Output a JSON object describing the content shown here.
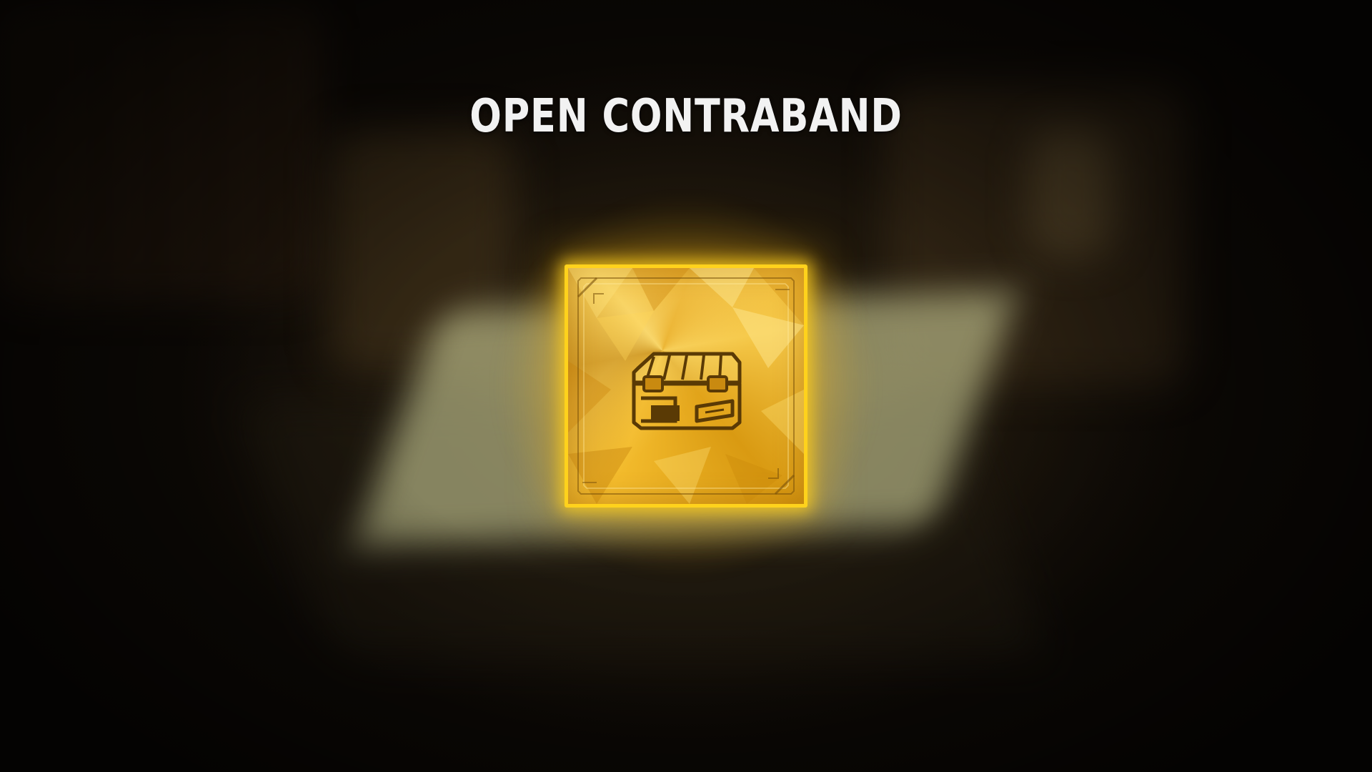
{
  "screen": {
    "title": "OPEN CONTRABAND"
  },
  "contraband_item": {
    "icon": "contraband-chest-icon",
    "rarity_color": "#ffd21c",
    "frame_color": "#e9ad20"
  }
}
